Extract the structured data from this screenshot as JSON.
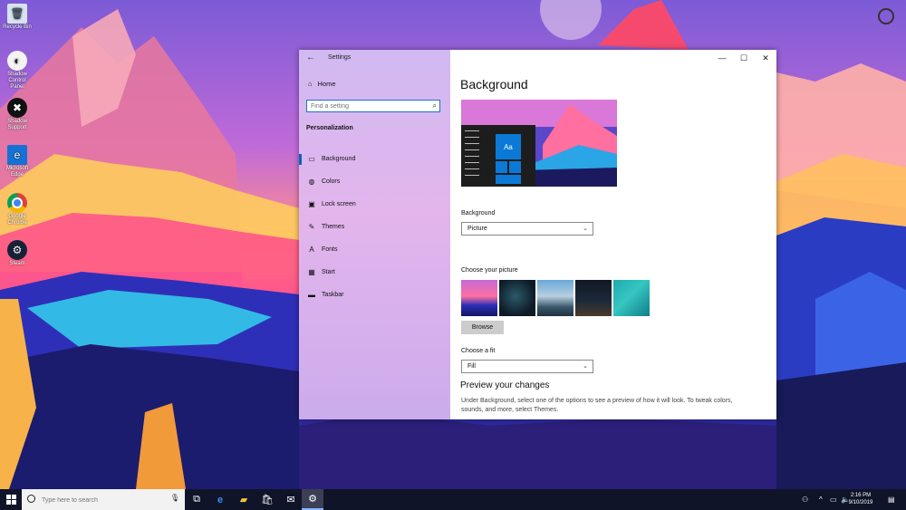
{
  "desktop": {
    "icons": [
      {
        "label": "Recycle Bin",
        "icon": "recycle-bin-icon"
      },
      {
        "label": "Shadow Control Panel",
        "icon": "shadow-control-panel-icon"
      },
      {
        "label": "Shadow Support",
        "icon": "shadow-support-icon"
      },
      {
        "label": "Microsoft Edge",
        "icon": "edge-icon"
      },
      {
        "label": "Google Chrome",
        "icon": "chrome-icon"
      },
      {
        "label": "Steam",
        "icon": "steam-icon"
      }
    ]
  },
  "window": {
    "title": "Settings",
    "controls": {
      "minimize": "—",
      "maximize": "☐",
      "close": "✕"
    }
  },
  "sidebar": {
    "home": "Home",
    "search_placeholder": "Find a setting",
    "section": "Personalization",
    "items": [
      {
        "label": "Background",
        "icon": "picture-icon",
        "active": true
      },
      {
        "label": "Colors",
        "icon": "palette-icon"
      },
      {
        "label": "Lock screen",
        "icon": "lock-screen-icon"
      },
      {
        "label": "Themes",
        "icon": "themes-icon"
      },
      {
        "label": "Fonts",
        "icon": "fonts-icon"
      },
      {
        "label": "Start",
        "icon": "start-icon"
      },
      {
        "label": "Taskbar",
        "icon": "taskbar-icon"
      }
    ]
  },
  "main": {
    "title": "Background",
    "preview_tile": "Aa",
    "background_label": "Background",
    "background_value": "Picture",
    "choose_picture_label": "Choose your picture",
    "browse": "Browse",
    "fit_label": "Choose a fit",
    "fit_value": "Fill",
    "preview_heading": "Preview your changes",
    "preview_desc": "Under Background, select one of the options to see a preview of how it will look. To tweak colors, sounds, and more, select Themes."
  },
  "taskbar": {
    "search_placeholder": "Type here to search",
    "time": "2:16 PM",
    "date": "9/10/2019"
  },
  "colors": {
    "accent": "#0067c0",
    "taskbar": "#101428"
  }
}
